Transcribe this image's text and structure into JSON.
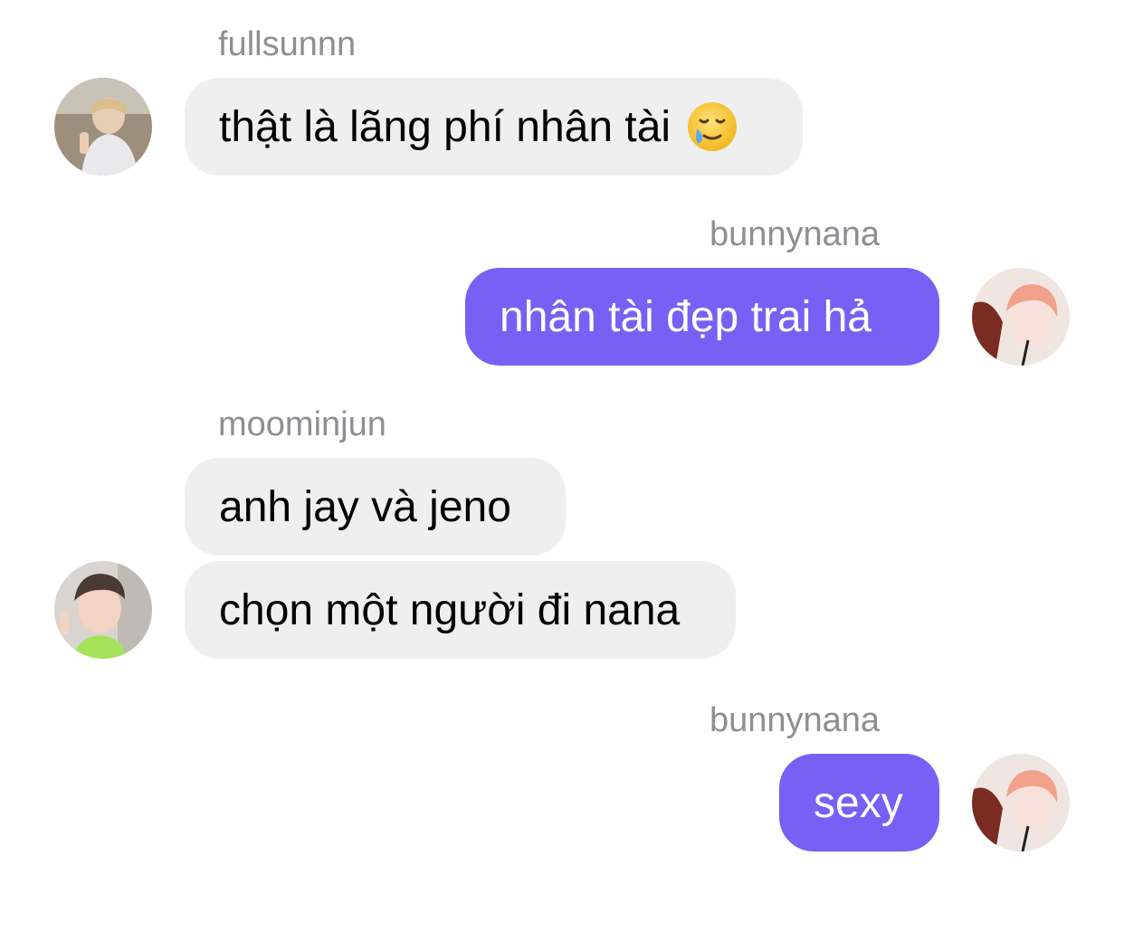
{
  "messages": [
    {
      "sender": "fullsunnn",
      "text": "thật là lãng phí nhân tài",
      "emoji": "smiling-face-with-tear-icon"
    },
    {
      "sender": "bunnynana",
      "text": "nhân tài đẹp trai hả"
    },
    {
      "sender": "moominjun",
      "text": "anh jay và jeno"
    },
    {
      "text": "chọn một người đi nana"
    },
    {
      "sender": "bunnynana",
      "text": "sexy"
    }
  ],
  "colors": {
    "incoming_bubble": "#efefef",
    "outgoing_bubble": "#7860f5",
    "sender_label": "#8e8e93"
  }
}
